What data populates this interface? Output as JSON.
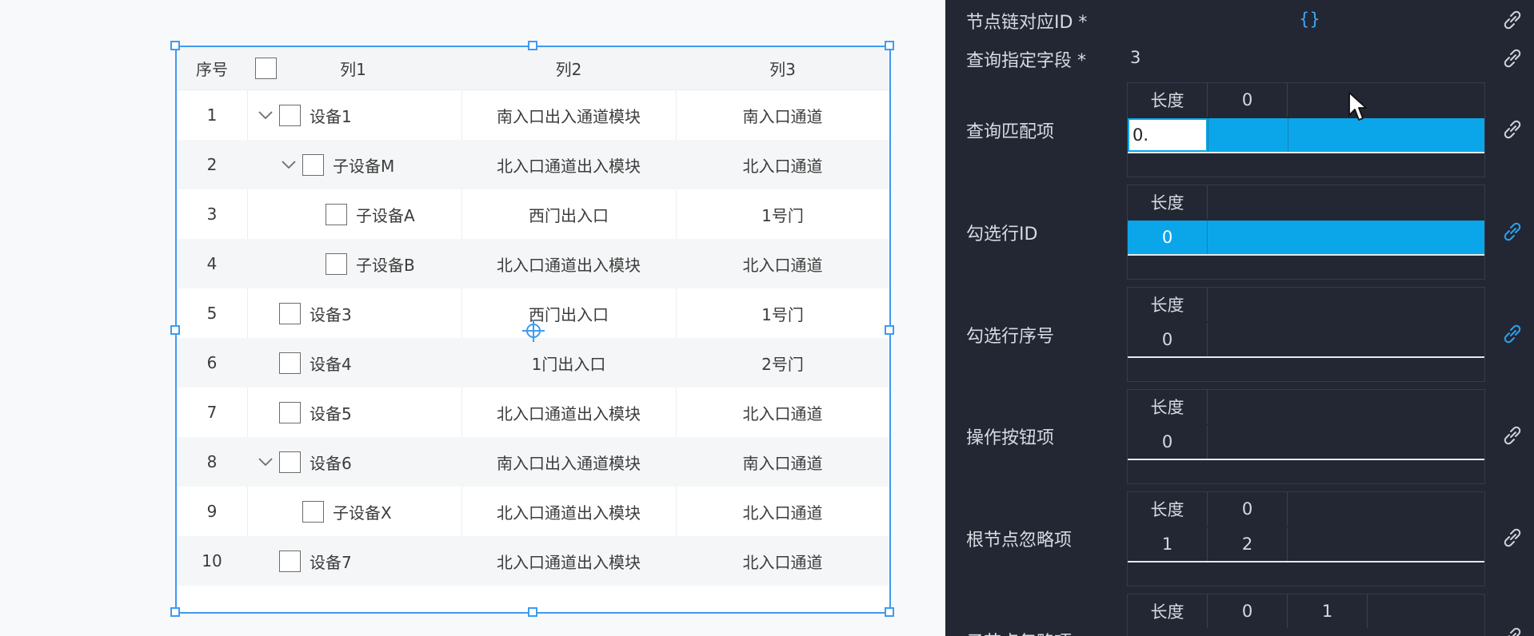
{
  "table": {
    "header": {
      "seq": "序号",
      "col1": "列1",
      "col2": "列2",
      "col3": "列3"
    },
    "rows": [
      {
        "seq": "1",
        "name": "设备1",
        "col2": "南入口出入通道模块",
        "col3": "南入口通道"
      },
      {
        "seq": "2",
        "name": "子设备M",
        "col2": "北入口通道出入模块",
        "col3": "北入口通道"
      },
      {
        "seq": "3",
        "name": "子设备A",
        "col2": "西门出入口",
        "col3": "1号门"
      },
      {
        "seq": "4",
        "name": "子设备B",
        "col2": "北入口通道出入模块",
        "col3": "北入口通道"
      },
      {
        "seq": "5",
        "name": "设备3",
        "col2": "西门出入口",
        "col3": "1号门"
      },
      {
        "seq": "6",
        "name": "设备4",
        "col2": "1门出入口",
        "col3": "2号门"
      },
      {
        "seq": "7",
        "name": "设备5",
        "col2": "北入口通道出入模块",
        "col3": "北入口通道"
      },
      {
        "seq": "8",
        "name": "设备6",
        "col2": "南入口出入通道模块",
        "col3": "南入口通道"
      },
      {
        "seq": "9",
        "name": "子设备X",
        "col2": "北入口通道出入模块",
        "col3": "北入口通道"
      },
      {
        "seq": "10",
        "name": "设备7",
        "col2": "北入口通道出入模块",
        "col3": "北入口通道"
      }
    ]
  },
  "panel": {
    "node_chain_id": {
      "label": "节点链对应ID *",
      "value": "{}"
    },
    "query_field": {
      "label": "查询指定字段 *",
      "value": "3"
    },
    "query_match": {
      "label": "查询匹配项",
      "header": [
        "长度",
        "0"
      ],
      "input_value": "0."
    },
    "checked_row_id": {
      "label": "勾选行ID",
      "header": [
        "长度"
      ],
      "values": [
        "0"
      ]
    },
    "checked_row_seq": {
      "label": "勾选行序号",
      "header": [
        "长度"
      ],
      "values": [
        "0"
      ]
    },
    "action_buttons": {
      "label": "操作按钮项",
      "header": [
        "长度"
      ],
      "values": [
        "0"
      ]
    },
    "root_ignore": {
      "label": "根节点忽略项",
      "header": [
        "长度",
        "0"
      ],
      "values": [
        "1",
        "2"
      ]
    },
    "child_ignore": {
      "label": "子节点忽略项",
      "header": [
        "长度",
        "0",
        "1"
      ]
    }
  },
  "colors": {
    "accent": "#0ba6ea",
    "selection": "#3f9bf0",
    "panel_bg": "#232733"
  }
}
